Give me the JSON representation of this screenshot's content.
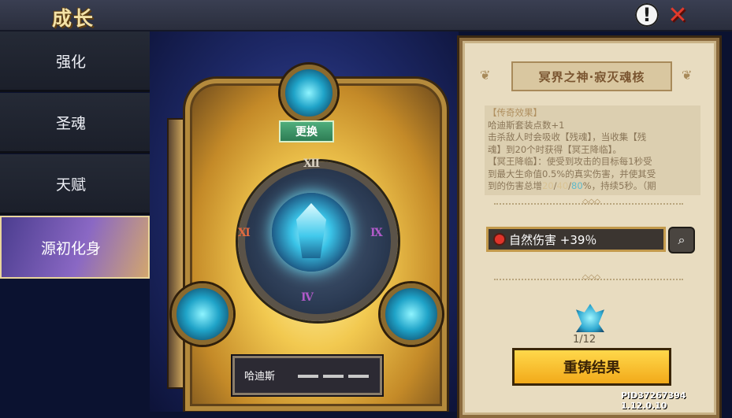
{
  "header": {
    "title": "成长",
    "info_icon": "!",
    "close_icon": "✕"
  },
  "sidebar": {
    "items": [
      {
        "label": "强化",
        "active": false
      },
      {
        "label": "圣魂",
        "active": false
      },
      {
        "label": "天赋",
        "active": false
      },
      {
        "label": "源初化身",
        "active": true
      }
    ]
  },
  "center": {
    "swap_label": "更换",
    "runes": [
      "Ⅻ",
      "Ⅺ",
      "Ⅸ",
      "Ⅳ"
    ],
    "character_name": "哈迪斯"
  },
  "panel": {
    "title": "冥界之神·寂灭魂核",
    "desc_header": "【传奇效果】",
    "desc_lines": [
      "哈迪斯套装点数+1",
      "击杀敌人时会吸收【残魂】，当收集【残",
      "魂】到20个时获得【冥王降临】。",
      "【冥王降临】：使受到攻击的目标每1秒受",
      "到最大生命值0.5%的真实伤害，并使其受"
    ],
    "desc_last_prefix": "到的伤害总增",
    "desc_last_v1": "20",
    "desc_last_s1": "/",
    "desc_last_v2": "40",
    "desc_last_s2": "/",
    "desc_last_v3": "80",
    "desc_last_suffix": "%，持续5秒。（期",
    "stat_text": "自然伤害 +39％",
    "material_count": "1/12",
    "recast_label": "重铸结果"
  },
  "version": "PID37267394 1.12.0.10",
  "colors": {
    "accent": "#f2aa1a",
    "swap": "#2e7d54",
    "stat_gem": "#e0342a"
  }
}
